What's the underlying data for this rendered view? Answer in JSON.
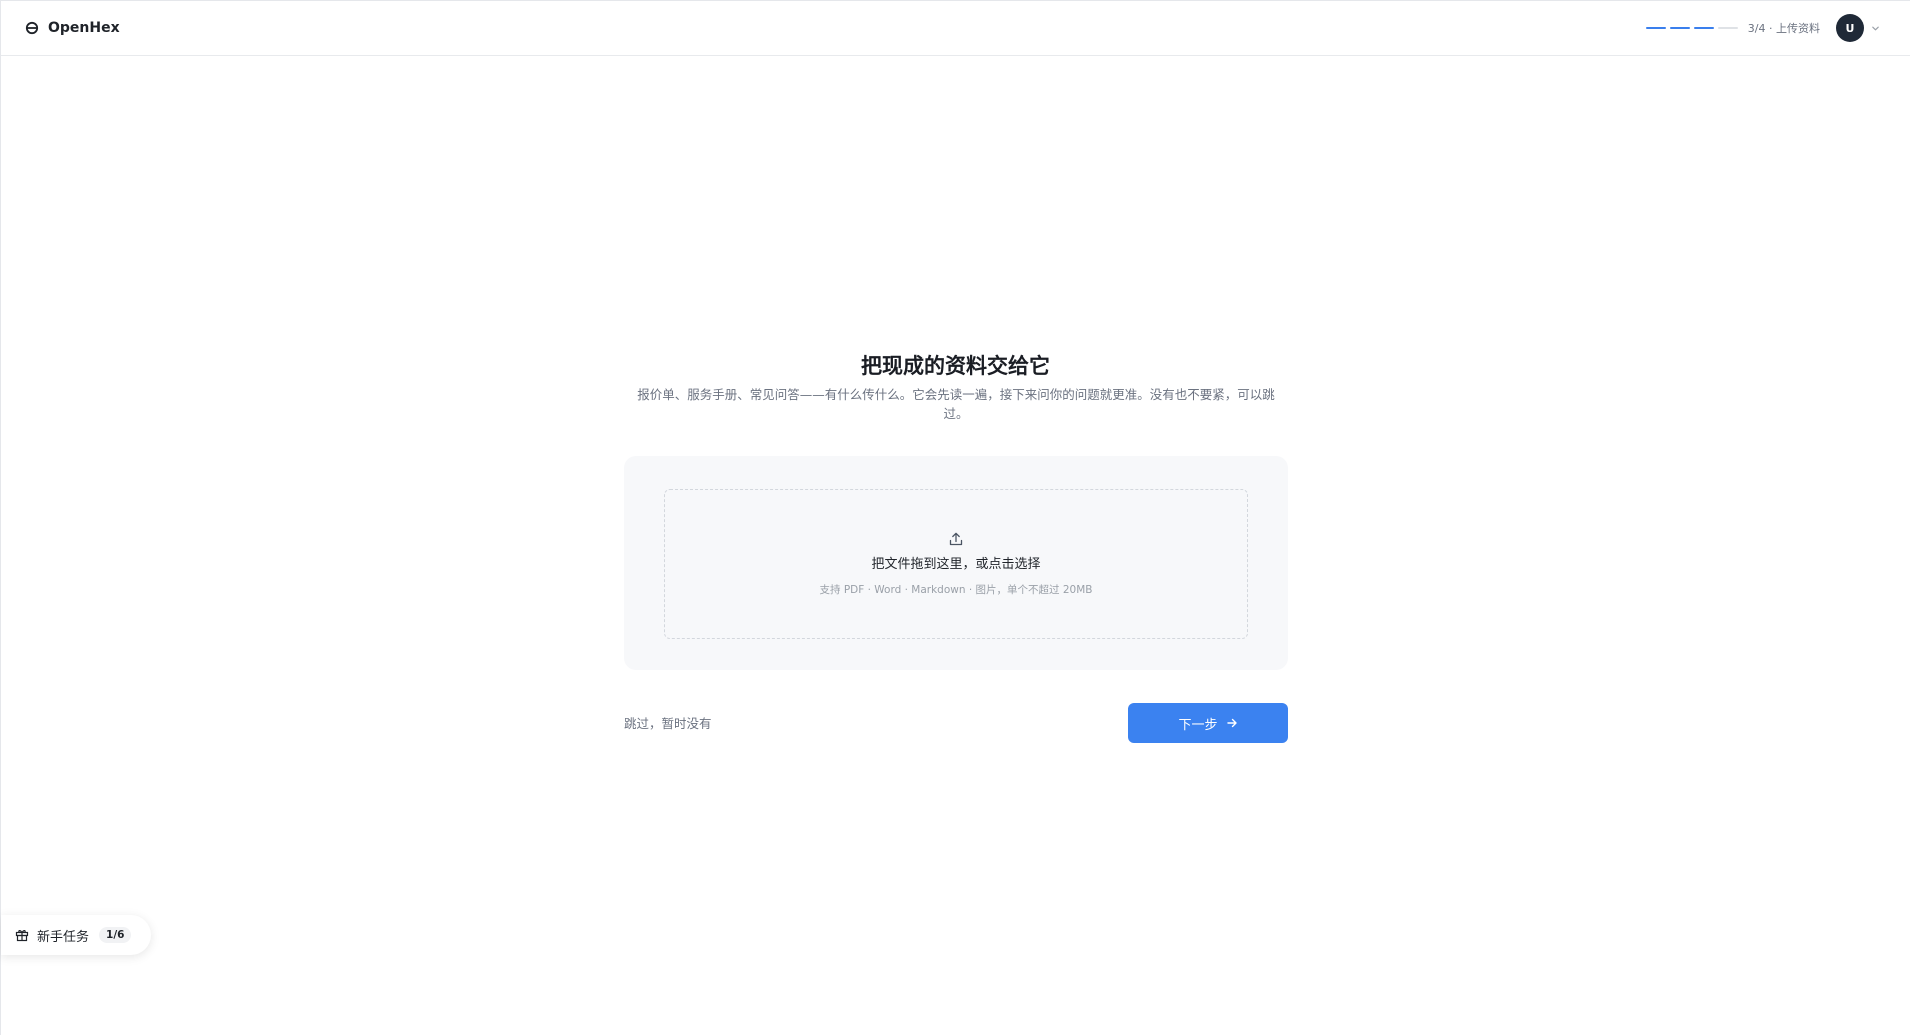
{
  "header": {
    "brand": "OpenHex",
    "progress": {
      "total_steps": 4,
      "current_step": 3
    },
    "step_label": "3/4 · 上传资料",
    "avatar_initial": "U"
  },
  "main": {
    "title": "把现成的资料交给它",
    "subtitle": "报价单、服务手册、常见问答——有什么传什么。它会先读一遍，接下来问你的问题就更准。没有也不要紧，可以跳过。",
    "upload": {
      "prompt": "把文件拖到这里，或点击选择",
      "hint": "支持 PDF · Word · Markdown · 图片，单个不超过 20MB"
    },
    "skip_label": "跳过，暂时没有",
    "next_label": "下一步"
  },
  "task_pill": {
    "label": "新手任务",
    "count": "1/6"
  },
  "colors": {
    "accent": "#3b82f0",
    "avatar_bg": "#1f2937",
    "card_bg": "#f7f8fa"
  },
  "icons": {
    "brand": "openhex-logo-icon",
    "chevron": "chevron-down-icon",
    "upload": "upload-icon",
    "arrow": "arrow-right-icon",
    "gift": "gift-icon"
  }
}
